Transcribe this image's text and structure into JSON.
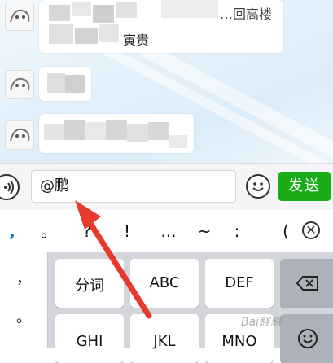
{
  "input_bar": {
    "input_value": "@鹏",
    "send_label": "发送"
  },
  "chat": {
    "visible_fragment": "寅贵",
    "top_fragment": "…回高楼"
  },
  "symbols": [
    ",",
    "。",
    "?",
    "!",
    "...",
    "~",
    ":",
    "("
  ],
  "keyboard": {
    "punct_top": "，",
    "punct_mid": "。",
    "keys": {
      "fenci": "分词",
      "abc": "ABC",
      "def": "DEF",
      "ghi": "GHI",
      "jkl": "JKL",
      "mno": "MNO"
    }
  },
  "colors": {
    "send_green": "#1aad19",
    "arrow_red": "#e8392f"
  },
  "icons": {
    "voice": "voice-icon",
    "emoji": "emoji-icon",
    "close": "close-circle-icon",
    "backspace": "backspace-icon",
    "emoji_key": "emoji-key-icon"
  },
  "watermark": "Bai経験"
}
